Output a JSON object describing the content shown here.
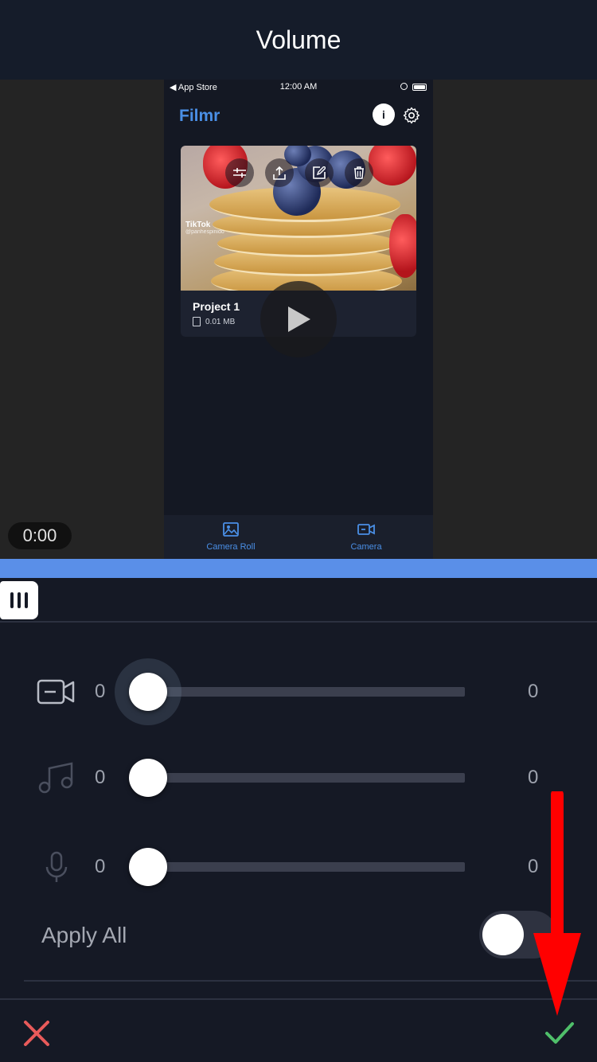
{
  "header": {
    "title": "Volume"
  },
  "preview": {
    "status_bar": {
      "carrier": "◀ App Store",
      "time": "12:00 AM"
    },
    "app_title": "Filmr",
    "info_label": "i",
    "project": {
      "name": "Project 1",
      "size": "0.01 MB",
      "watermark": "TikTok",
      "watermark_user": "@panhespinido"
    },
    "tabs": [
      {
        "label": "Camera Roll",
        "icon": "image-icon"
      },
      {
        "label": "Camera",
        "icon": "video-camera-icon"
      }
    ],
    "current_time": "0:00"
  },
  "volume": {
    "rows": [
      {
        "icon": "video-camera-icon",
        "min": "0",
        "max": "0",
        "level": 0
      },
      {
        "icon": "music-note-icon",
        "min": "0",
        "max": "0",
        "level": 0
      },
      {
        "icon": "microphone-icon",
        "min": "0",
        "max": "0",
        "level": 0
      }
    ],
    "apply_all_label": "Apply All",
    "apply_all_on": false
  },
  "colors": {
    "background": "#151925",
    "accent": "#5a8fe8",
    "brand": "#4a8fe6",
    "cancel": "#e85a5a",
    "confirm": "#4fbf6a",
    "annotation_arrow": "#ff0000"
  }
}
